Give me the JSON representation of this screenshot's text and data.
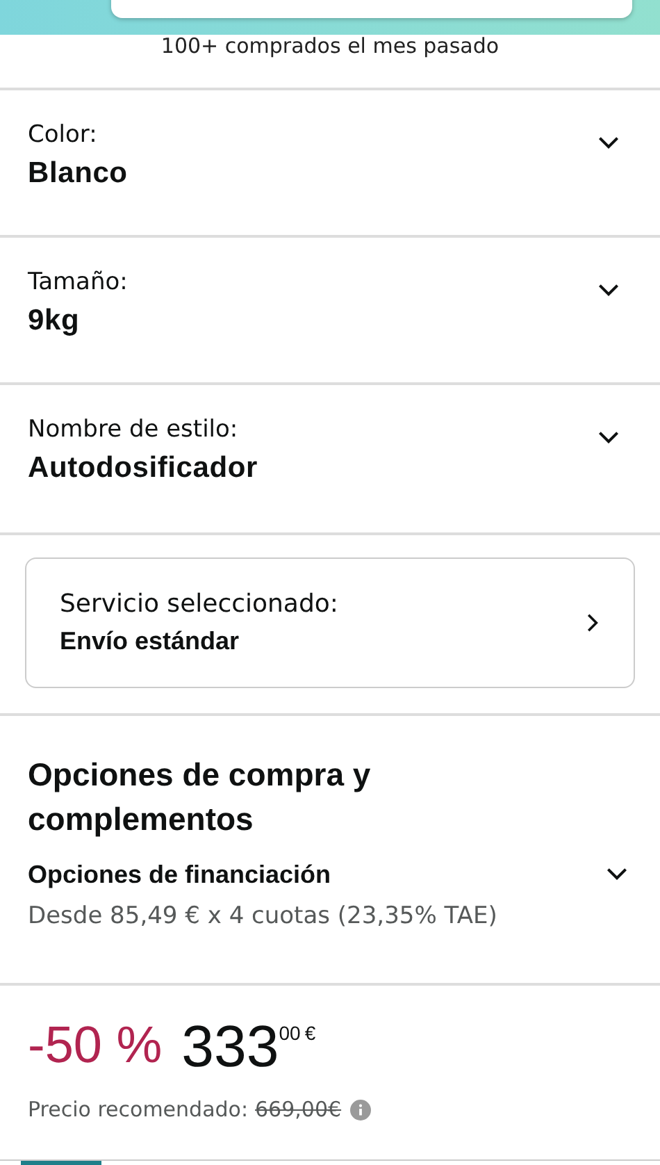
{
  "social_proof": "100+ comprados el mes pasado",
  "selectors": [
    {
      "label": "Color:",
      "value": "Blanco",
      "expanded": false
    },
    {
      "label": "Tamaño:",
      "value": "9kg",
      "expanded": false
    },
    {
      "label": "Nombre de estilo:",
      "value": "Autodosificador",
      "expanded": false
    }
  ],
  "service": {
    "label": "Servicio seleccionado:",
    "value": "Envío estándar"
  },
  "purchase_options": {
    "title": "Opciones de compra y complementos",
    "financing_title": "Opciones de financiación",
    "financing_detail": "Desde 85,49 € x 4 cuotas (23,35% TAE)",
    "expanded": false
  },
  "price": {
    "discount": "-50 %",
    "whole": "333",
    "fraction": "00",
    "currency": "€",
    "list_label": "Precio recomendado:",
    "list_price": "669,00€"
  }
}
